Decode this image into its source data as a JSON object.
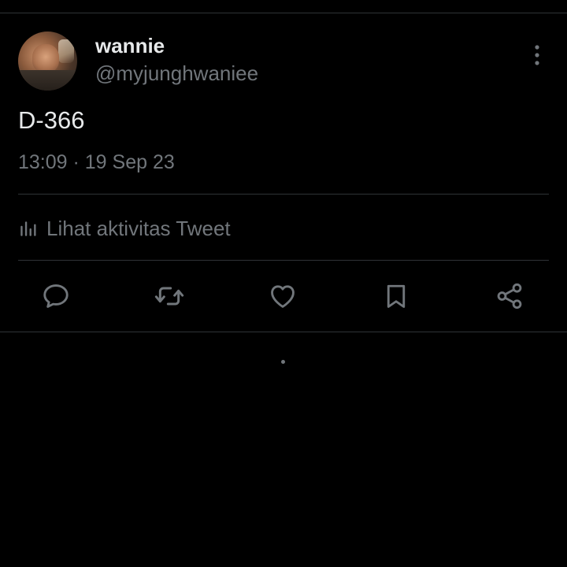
{
  "tweet": {
    "display_name": "wannie",
    "handle": "@myjunghwaniee",
    "text": "D-366",
    "timestamp": "13:09 · 19 Sep 23"
  },
  "activity": {
    "label": "Lihat aktivitas Tweet",
    "icon": "analytics-icon"
  },
  "actions": [
    {
      "name": "reply",
      "icon": "reply-icon"
    },
    {
      "name": "retweet",
      "icon": "retweet-icon"
    },
    {
      "name": "like",
      "icon": "heart-icon"
    },
    {
      "name": "bookmark",
      "icon": "bookmark-icon"
    },
    {
      "name": "share",
      "icon": "share-icon"
    }
  ],
  "colors": {
    "background": "#000000",
    "primary_text": "#e7e9ea",
    "secondary_text": "#71767b",
    "divider": "#2f3336"
  }
}
